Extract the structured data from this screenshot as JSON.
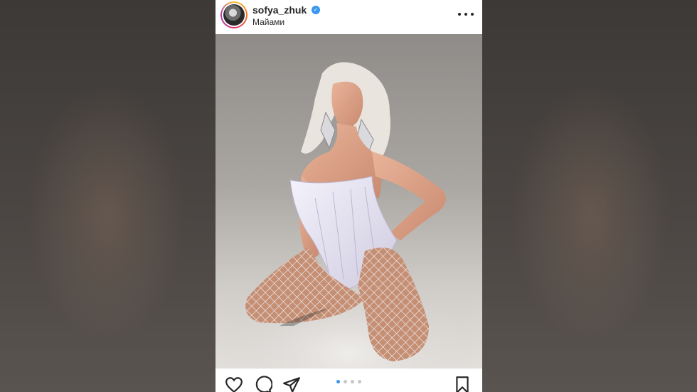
{
  "post": {
    "username": "sofya_zhuk",
    "verified": true,
    "location": "Майами",
    "carousel": {
      "total": 4,
      "current": 1
    }
  },
  "icons": {
    "verified": "verified-badge-icon",
    "more": "more-options-icon",
    "like": "heart-icon",
    "comment": "comment-icon",
    "share": "paper-plane-icon",
    "save": "bookmark-icon"
  },
  "colors": {
    "accent": "#3897f0",
    "text": "#262626"
  }
}
